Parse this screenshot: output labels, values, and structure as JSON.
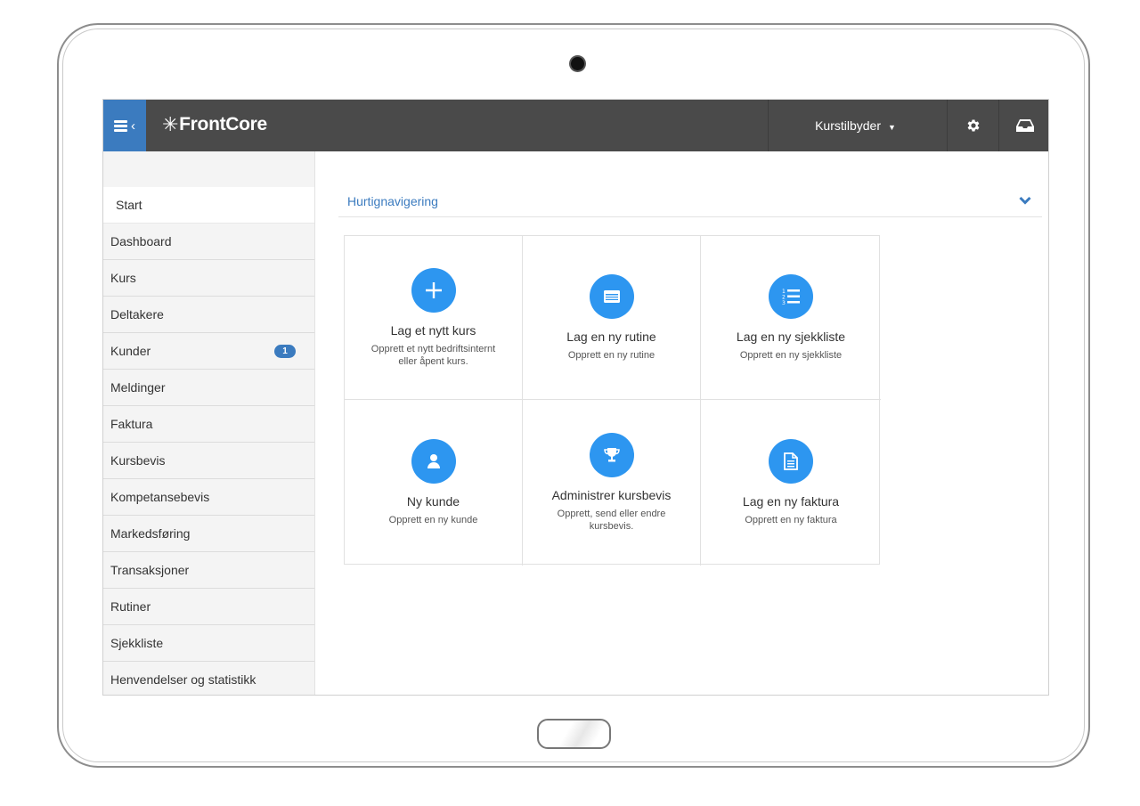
{
  "app": {
    "logo_text": "FrontCore",
    "accent": "#3b7bbf",
    "icon_blue": "#2d96f0",
    "topbar_bg": "#4a4a4a"
  },
  "topbar": {
    "role_label": "Kurstilbyder"
  },
  "sidebar": {
    "items": [
      {
        "label": "Start",
        "active": true
      },
      {
        "label": "Dashboard"
      },
      {
        "label": "Kurs"
      },
      {
        "label": "Deltakere"
      },
      {
        "label": "Kunder",
        "badge": "1"
      },
      {
        "label": "Meldinger"
      },
      {
        "label": "Faktura"
      },
      {
        "label": "Kursbevis"
      },
      {
        "label": "Kompetansebevis"
      },
      {
        "label": "Markedsføring"
      },
      {
        "label": "Transaksjoner"
      },
      {
        "label": "Rutiner"
      },
      {
        "label": "Sjekkliste"
      },
      {
        "label": "Henvendelser og statistikk"
      }
    ]
  },
  "main": {
    "section_title": "Hurtignavigering",
    "tiles": [
      {
        "icon": "plus-icon",
        "title": "Lag et nytt kurs",
        "desc": "Opprett et nytt bedriftsinternt eller åpent kurs."
      },
      {
        "icon": "calendar-icon",
        "title": "Lag en ny rutine",
        "desc": "Opprett en ny rutine"
      },
      {
        "icon": "numbered-list-icon",
        "title": "Lag en ny sjekkliste",
        "desc": "Opprett en ny sjekkliste"
      },
      {
        "icon": "user-icon",
        "title": "Ny kunde",
        "desc": "Opprett en ny kunde"
      },
      {
        "icon": "trophy-icon",
        "title": "Administrer kursbevis",
        "desc": "Opprett, send eller endre kursbevis."
      },
      {
        "icon": "document-icon",
        "title": "Lag en ny faktura",
        "desc": "Opprett en ny faktura"
      }
    ]
  }
}
